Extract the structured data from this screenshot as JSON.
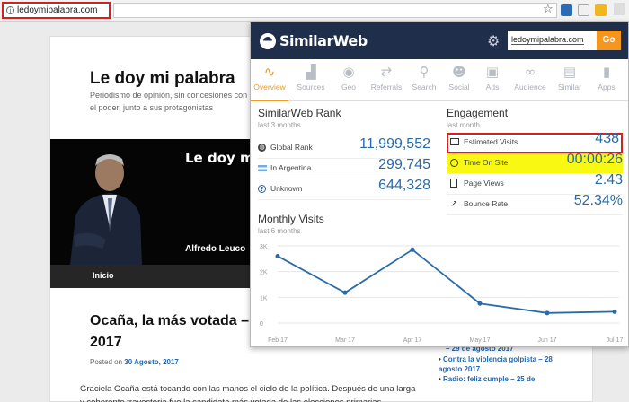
{
  "browser": {
    "url": "ledoymipalabra.com"
  },
  "site": {
    "title": "Le doy mi palabra",
    "tagline": "Periodismo de opinión, sin concesiones con el poder, junto a sus protagonistas",
    "banner_title": "Le doy m",
    "banner_name": "Alfredo Leuco",
    "nav_item": "Inicio",
    "post_title": "Ocaña, la más votada – 2017",
    "posted_prefix": "Posted on",
    "posted_date": "30 Agosto, 2017",
    "excerpt": "Graciela Ocaña está tocando con las manos el cielo de la política. Después de una larga y coherente trayectoria fue la candidata más votada de las elecciones primarias",
    "sidebar_links": [
      {
        "text": "– 29 de agosto 2017",
        "bullet": false
      },
      {
        "text": "Contra la violencia golpista – 28 agosto 2017",
        "bullet": true
      },
      {
        "text": "Radio: feliz cumple – 25 de",
        "bullet": true
      }
    ]
  },
  "similarweb": {
    "logo": "SimilarWeb",
    "search_value": "ledoymipalabra.com",
    "go_label": "Go",
    "tabs": [
      {
        "label": "Overview",
        "icon": "overview-icon",
        "active": true
      },
      {
        "label": "Sources",
        "icon": "sources-icon",
        "active": false
      },
      {
        "label": "Geo",
        "icon": "geo-icon",
        "active": false
      },
      {
        "label": "Referrals",
        "icon": "referrals-icon",
        "active": false
      },
      {
        "label": "Search",
        "icon": "search-icon",
        "active": false
      },
      {
        "label": "Social",
        "icon": "social-icon",
        "active": false
      },
      {
        "label": "Ads",
        "icon": "ads-icon",
        "active": false
      },
      {
        "label": "Audience",
        "icon": "audience-icon",
        "active": false
      },
      {
        "label": "Similar",
        "icon": "similar-icon",
        "active": false
      },
      {
        "label": "Apps",
        "icon": "apps-icon",
        "active": false
      }
    ],
    "rank": {
      "title": "SimilarWeb Rank",
      "subtitle": "last 3 months",
      "rows": [
        {
          "label": "Global Rank",
          "value": "11,999,552",
          "icon": "globe-icon"
        },
        {
          "label": "In Argentina",
          "value": "299,745",
          "icon": "argentina-flag-icon"
        },
        {
          "label": "Unknown",
          "value": "644,328",
          "icon": "question-icon"
        }
      ]
    },
    "engagement": {
      "title": "Engagement",
      "subtitle": "last month",
      "rows": [
        {
          "label": "Estimated Visits",
          "value": "438",
          "icon": "monitor-icon"
        },
        {
          "label": "Time On Site",
          "value": "00:00:26",
          "icon": "clock-icon"
        },
        {
          "label": "Page Views",
          "value": "2.43",
          "icon": "pages-icon"
        },
        {
          "label": "Bounce Rate",
          "value": "52.34%",
          "icon": "bounce-arrow-icon"
        }
      ]
    },
    "monthly": {
      "title": "Monthly Visits",
      "subtitle": "last 6 months"
    }
  },
  "chart_data": {
    "type": "line",
    "title": "Monthly Visits",
    "subtitle": "last 6 months",
    "categories": [
      "Feb 17",
      "Mar 17",
      "Apr 17",
      "May 17",
      "Jun 17",
      "Jul 17"
    ],
    "series": [
      {
        "values": [
          2600,
          1180,
          2850,
          760,
          390,
          440
        ]
      }
    ],
    "y_ticks": [
      "3K",
      "2K",
      "1K",
      "0"
    ],
    "ylim": [
      0,
      3000
    ],
    "grid": true,
    "color": "#2a6aa8"
  },
  "colors": {
    "accent": "#f5961f",
    "header": "#1f2e4a",
    "value": "#2a6aa8",
    "highlight_box": "#d42020",
    "highlight_fill": "#f8f812"
  }
}
